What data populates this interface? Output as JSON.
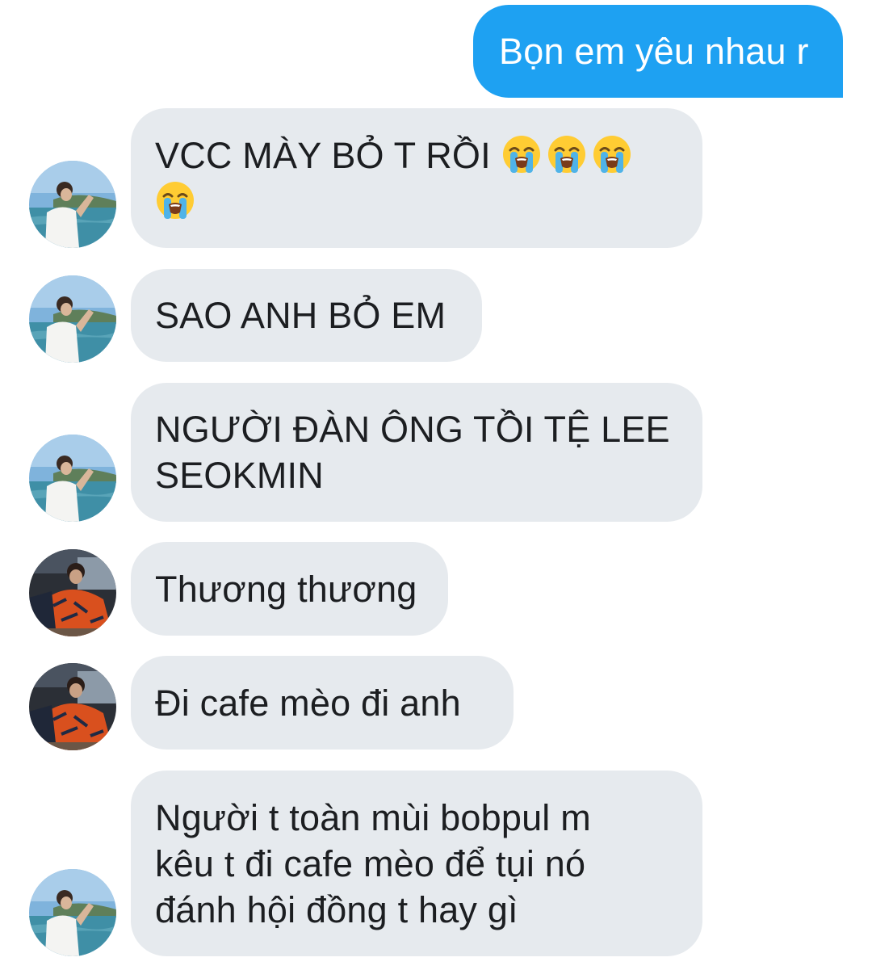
{
  "conversation": {
    "outgoing": [
      {
        "text": "Bọn em yêu nhau r"
      }
    ],
    "incoming": [
      {
        "text": "VCC MÀY BỎ T RỒI",
        "emoji_name": "loudly-crying-face-emoji",
        "emoji_count": 4
      },
      {
        "text": "SAO ANH BỎ EM"
      },
      {
        "text": "NGƯỜI ĐÀN ÔNG TỒI TỆ LEE SEOKMIN"
      },
      {
        "text": "Thương thương"
      },
      {
        "text": "Đi cafe mèo đi anh"
      },
      {
        "text": "Người t toàn mùi bobpul m kêu t đi cafe mèo để tụi nó đánh hội đồng t hay gì"
      }
    ]
  },
  "colors": {
    "outgoing_bubble": "#1ea1f2",
    "incoming_bubble": "#e6eaee",
    "background": "#ffffff"
  }
}
